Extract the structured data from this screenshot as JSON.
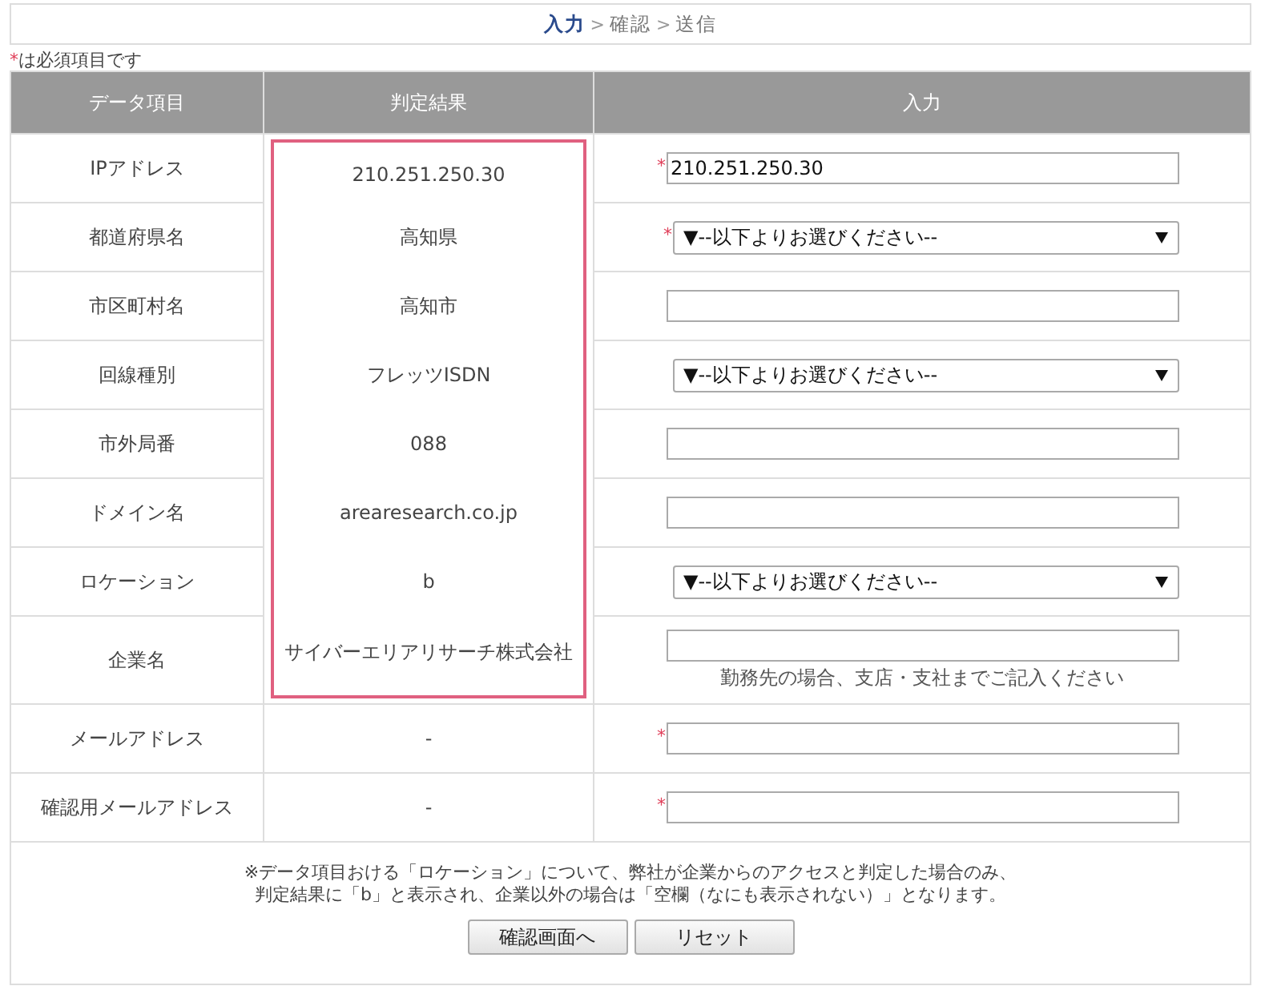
{
  "steps": [
    {
      "label": "入力",
      "selected": true
    },
    {
      "separator": ">"
    },
    {
      "label": "確認",
      "selected": false
    },
    {
      "separator": ">"
    },
    {
      "label": "送信",
      "selected": false
    }
  ],
  "required_note": {
    "mark": "*",
    "text": "は必須項目です"
  },
  "table": {
    "columns": [
      "データ項目",
      "判定結果",
      "入力"
    ],
    "rows": [
      {
        "label": "IPアドレス",
        "result": "210.251.250.30",
        "highlighted": true,
        "input": {
          "kind": "text",
          "required": true,
          "value": "210.251.250.30"
        }
      },
      {
        "label": "都道府県名",
        "result": "高知県",
        "highlighted": true,
        "input": {
          "kind": "select",
          "required": true,
          "value": "▼--以下よりお選びください--"
        }
      },
      {
        "label": "市区町村名",
        "result": "高知市",
        "highlighted": true,
        "input": {
          "kind": "text",
          "required": false
        }
      },
      {
        "label": "回線種別",
        "result": "フレッツISDN",
        "highlighted": true,
        "input": {
          "kind": "select",
          "required": false,
          "value": "▼--以下よりお選びください--"
        }
      },
      {
        "label": "市外局番",
        "result": "088",
        "highlighted": true,
        "input": {
          "kind": "text",
          "required": false
        }
      },
      {
        "label": "ドメイン名",
        "result": "arearesearch.co.jp",
        "highlighted": true,
        "input": {
          "kind": "text",
          "required": false
        }
      },
      {
        "label": "ロケーション",
        "result": "b",
        "highlighted": true,
        "input": {
          "kind": "select",
          "required": false,
          "value": "▼--以下よりお選びください--"
        }
      },
      {
        "label": "企業名",
        "result": "サイバーエリアリサーチ株式会社",
        "highlighted": true,
        "input": {
          "kind": "text",
          "required": false,
          "note": "勤務先の場合、支店・支社までご記入ください"
        }
      },
      {
        "label": "メールアドレス",
        "result": "-",
        "highlighted": false,
        "input": {
          "kind": "text",
          "required": true
        }
      },
      {
        "label": "確認用メールアドレス",
        "result": "-",
        "highlighted": false,
        "input": {
          "kind": "text",
          "required": true
        }
      }
    ]
  },
  "footnote": [
    "※データ項目おける「ロケーション」について、弊社が企業からのアクセスと判定した場合のみ、",
    "判定結果に「b」と表示され、企業以外の場合は「空欄（なにも表示されない）」となります。"
  ],
  "buttons": [
    "確認画面へ",
    "リセット"
  ]
}
